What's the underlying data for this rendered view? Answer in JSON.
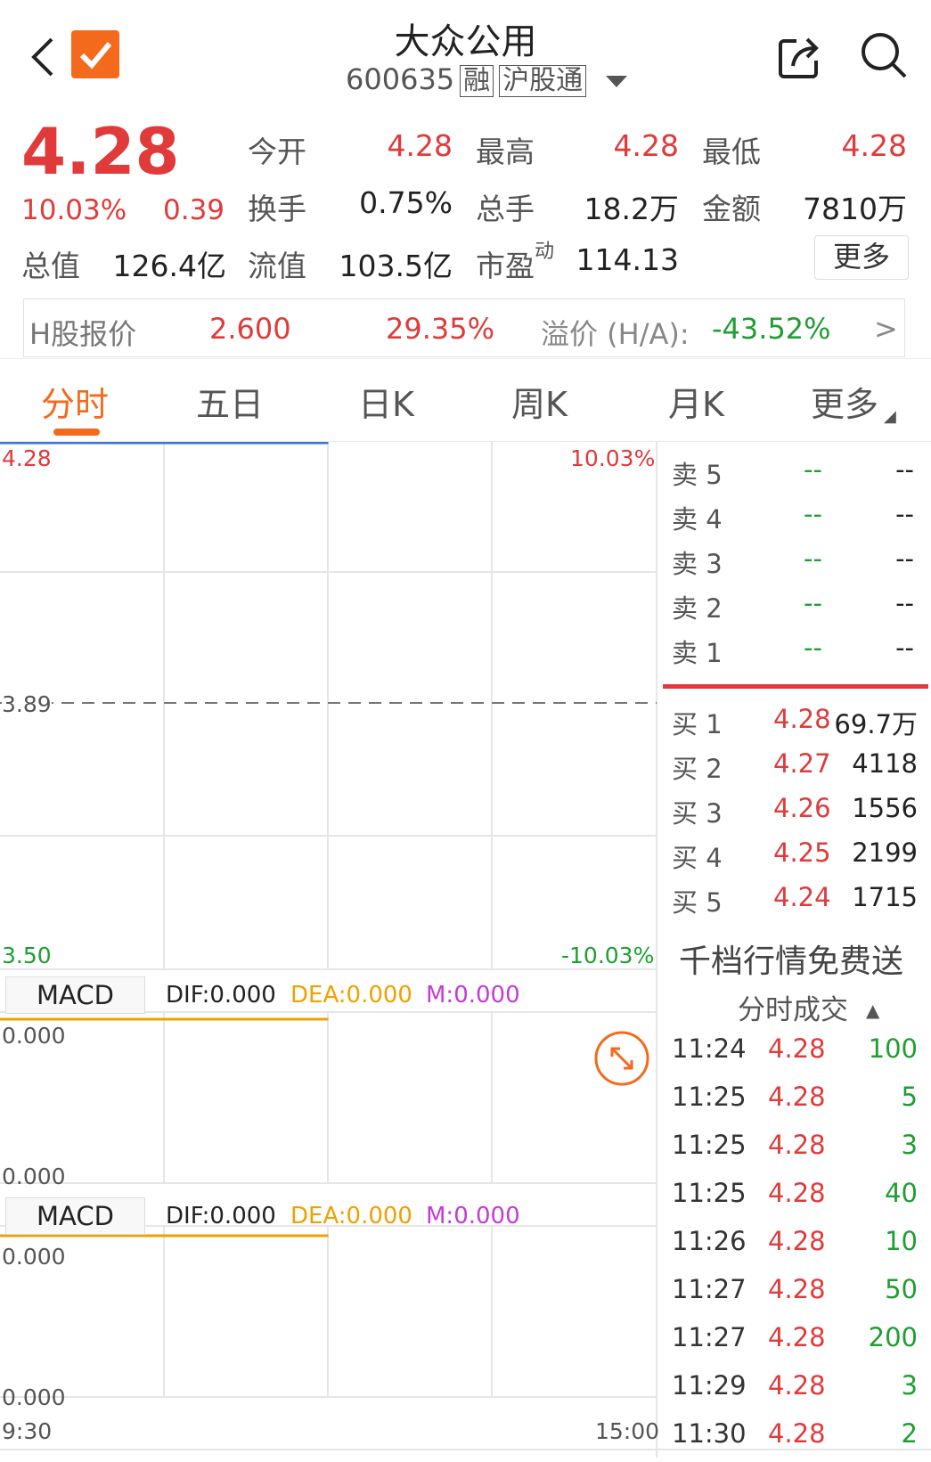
{
  "header": {
    "title": "大众公用",
    "code": "600635",
    "tag_rong": "融",
    "tag_hugutong": "沪股通"
  },
  "quote": {
    "price": "4.28",
    "change_pct": "10.03%",
    "change": "0.39",
    "fields": [
      {
        "label": "今开",
        "value": "4.28",
        "color": "red"
      },
      {
        "label": "最高",
        "value": "4.28",
        "color": "red"
      },
      {
        "label": "最低",
        "value": "4.28",
        "color": "red"
      },
      {
        "label": "换手",
        "value": "0.75%",
        "color": "black"
      },
      {
        "label": "总手",
        "value": "18.2万",
        "color": "black"
      },
      {
        "label": "金额",
        "value": "7810万",
        "color": "black"
      },
      {
        "label": "总值",
        "value": "126.4亿",
        "color": "black"
      },
      {
        "label": "流值",
        "value": "103.5亿",
        "color": "black"
      },
      {
        "label": "市盈",
        "label_sup": "动",
        "value": "114.13",
        "color": "black"
      }
    ],
    "more_label": "更多"
  },
  "hshare": {
    "label": "H股报价",
    "price": "2.600",
    "pct": "29.35%",
    "premium_label": "溢价 (H/A):",
    "premium": "-43.52%",
    "arrow": ">"
  },
  "tabs": [
    "分时",
    "五日",
    "日K",
    "周K",
    "月K",
    "更多"
  ],
  "chart": {
    "y_top": "4.28",
    "y_mid": "3.89",
    "y_bottom": "3.50",
    "pct_top": "10.03%",
    "pct_bottom": "-10.03%",
    "x_start": "9:30",
    "x_end": "15:00",
    "progress_fraction": 0.5
  },
  "macd": [
    {
      "tab": "MACD",
      "dif": "DIF:0.000",
      "dea": "DEA:0.000",
      "m": "M:0.000",
      "y_top": "0.000",
      "y_bottom": "0.000"
    },
    {
      "tab": "MACD",
      "dif": "DIF:0.000",
      "dea": "DEA:0.000",
      "m": "M:0.000",
      "y_top": "0.000",
      "y_bottom": "0.000"
    }
  ],
  "orderbook": {
    "sell": [
      {
        "label": "卖 5",
        "price": "--",
        "vol": "--"
      },
      {
        "label": "卖 4",
        "price": "--",
        "vol": "--"
      },
      {
        "label": "卖 3",
        "price": "--",
        "vol": "--"
      },
      {
        "label": "卖 2",
        "price": "--",
        "vol": "--"
      },
      {
        "label": "卖 1",
        "price": "--",
        "vol": "--"
      }
    ],
    "buy": [
      {
        "label": "买 1",
        "price": "4.28",
        "vol": "69.7万"
      },
      {
        "label": "买 2",
        "price": "4.27",
        "vol": "4118"
      },
      {
        "label": "买 3",
        "price": "4.26",
        "vol": "1556"
      },
      {
        "label": "买 4",
        "price": "4.25",
        "vol": "2199"
      },
      {
        "label": "买 5",
        "price": "4.24",
        "vol": "1715"
      }
    ]
  },
  "promo": "千档行情免费送",
  "trades_title": "分时成交",
  "trades": [
    {
      "time": "11:24",
      "price": "4.28",
      "vol": "100"
    },
    {
      "time": "11:25",
      "price": "4.28",
      "vol": "5"
    },
    {
      "time": "11:25",
      "price": "4.28",
      "vol": "3"
    },
    {
      "time": "11:25",
      "price": "4.28",
      "vol": "40"
    },
    {
      "time": "11:26",
      "price": "4.28",
      "vol": "10"
    },
    {
      "time": "11:27",
      "price": "4.28",
      "vol": "50"
    },
    {
      "time": "11:27",
      "price": "4.28",
      "vol": "200"
    },
    {
      "time": "11:29",
      "price": "4.28",
      "vol": "3"
    },
    {
      "time": "11:30",
      "price": "4.28",
      "vol": "2"
    }
  ],
  "colors": {
    "accent": "#f36a1d",
    "up": "#e03a3a",
    "down": "#1f9e32",
    "price_line": "#3a76d8",
    "dea": "#f0a000",
    "m": "#c43bd6"
  }
}
